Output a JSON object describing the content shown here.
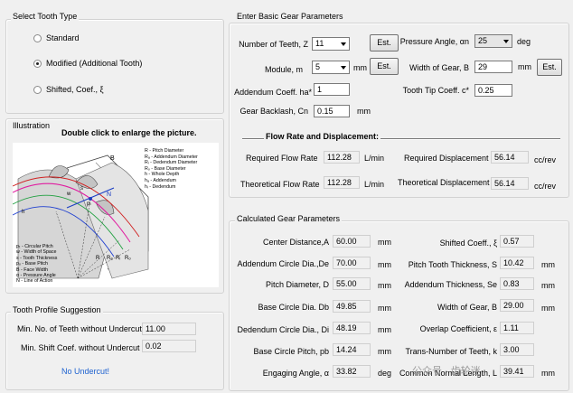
{
  "tooth_type": {
    "title": "Select Tooth Type",
    "options": [
      "Standard",
      "Modified (Additional Tooth)",
      "Shifted, Coef., ξ"
    ],
    "selected": 1
  },
  "illustration": {
    "title": "Illustration",
    "hint": "Double click to enlarge the picture.",
    "legend_right": [
      "R - Pitch Diameter",
      "Rₐ - Addendum Diameter",
      "Rᵢ - Dedendum Diameter",
      "Rₒ - Base Diameter",
      "h - Whole Depth",
      "hₐ - Addendum",
      "hᵢ - Dedendum"
    ],
    "legend_left": [
      "pₜ - Circular Pitch",
      "w - Width of Space",
      "s - Tooth Thickness",
      "pₒ - Base Pitch",
      "B - Face Width",
      "α - Pressure Angle",
      "N - Line of Action"
    ],
    "marks": [
      "B",
      "R",
      "Rₐ",
      "Rᵢ",
      "Rₒ",
      "N",
      "pₜ",
      "s",
      "w",
      "h"
    ]
  },
  "profile": {
    "title": "Tooth Profile Suggestion",
    "min_teeth_label": "Min. No. of Teeth without Undercut",
    "min_teeth_value": "11.00",
    "min_shift_label": "Min. Shift Coef. without Undercut",
    "min_shift_value": "0.02",
    "status": "No Undercut!"
  },
  "basic": {
    "title": "Enter Basic Gear Parameters",
    "teeth_label": "Number of Teeth, Z",
    "teeth_value": "11",
    "module_label": "Module, m",
    "module_value": "5",
    "module_unit": "mm",
    "addendum_label": "Addendum Coeff. ha*",
    "addendum_value": "1",
    "backlash_label": "Gear Backlash, Cn",
    "backlash_value": "0.15",
    "backlash_unit": "mm",
    "pressure_label": "Pressure Angle, αn",
    "pressure_value": "25",
    "pressure_unit": "deg",
    "width_label": "Width of Gear, B",
    "width_value": "29",
    "width_unit": "mm",
    "tip_label": "Tooth Tip Coeff. c*",
    "tip_value": "0.25",
    "est_label": "Est."
  },
  "flow": {
    "title": "Flow Rate and Displacement:",
    "req_flow_label": "Required Flow Rate",
    "req_flow_value": "112.28",
    "req_flow_unit": "L/min",
    "theo_flow_label": "Theoretical Flow Rate",
    "theo_flow_value": "112.28",
    "theo_flow_unit": "L/min",
    "req_disp_label": "Required Displacement",
    "req_disp_value": "56.14",
    "req_disp_unit": "cc/rev",
    "theo_disp_label": "Theoretical Displacement",
    "theo_disp_value": "56.14",
    "theo_disp_unit": "cc/rev"
  },
  "calc": {
    "title": "Calculated Gear Parameters",
    "left": [
      {
        "label": "Center Distance,A",
        "value": "60.00",
        "unit": "mm"
      },
      {
        "label": "Addendum Circle Dia.,De",
        "value": "70.00",
        "unit": "mm"
      },
      {
        "label": "Pitch Diameter, D",
        "value": "55.00",
        "unit": "mm"
      },
      {
        "label": "Base Circle Dia. Db",
        "value": "49.85",
        "unit": "mm"
      },
      {
        "label": "Dedendum Circle Dia., Di",
        "value": "48.19",
        "unit": "mm"
      },
      {
        "label": "Base Circle Pitch, pb",
        "value": "14.24",
        "unit": "mm"
      },
      {
        "label": "Engaging Angle, α",
        "value": "33.82",
        "unit": "deg"
      }
    ],
    "right": [
      {
        "label": "Shifted Coeff., ξ",
        "value": "0.57",
        "unit": ""
      },
      {
        "label": "Pitch Tooth Thickness, S",
        "value": "10.42",
        "unit": "mm"
      },
      {
        "label": "Addendum Thickness, Se",
        "value": "0.83",
        "unit": "mm"
      },
      {
        "label": "Width of Gear, B",
        "value": "29.00",
        "unit": "mm"
      },
      {
        "label": "Overlap Coefficient, ε",
        "value": "1.11",
        "unit": ""
      },
      {
        "label": "Trans-Number of Teeth, k",
        "value": "3.00",
        "unit": ""
      },
      {
        "label": "Common Normal Length, L",
        "value": "39.41",
        "unit": "mm"
      }
    ]
  },
  "watermark": "公众号 · 齿轮迷"
}
